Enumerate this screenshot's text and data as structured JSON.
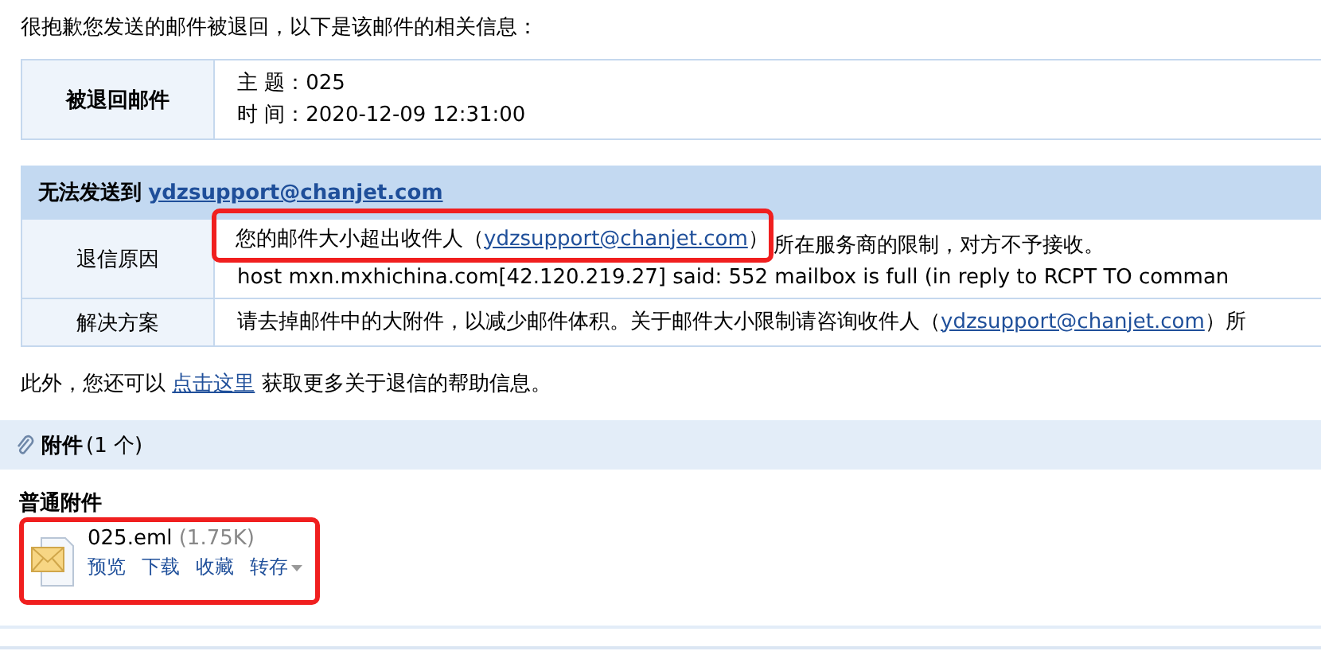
{
  "intro": "很抱歉您发送的邮件被退回，以下是该邮件的相关信息：",
  "returned_mail": {
    "label": "被退回邮件",
    "lines": [
      "主 题：025",
      "时 间：2020-12-09 12:31:00"
    ]
  },
  "failure": {
    "heading": "无法发送到",
    "address": "ydzsupport@chanjet.com",
    "rows": [
      {
        "label": "退信原因",
        "lines": [
          {
            "before": "您的邮件大小超出收件人（",
            "link": "ydzsupport@chanjet.com",
            "close": "）",
            "after": "所在服务商的限制，对方不予接收。",
            "highlighted": true
          },
          {
            "before": "host mxn.mxhichina.com[42.120.219.27] said: 552 mailbox is full (in reply to RCPT TO comman",
            "highlighted": false
          }
        ]
      },
      {
        "label": "解决方案",
        "lines": [
          {
            "before": "请去掉邮件中的大附件，以减少邮件体积。关于邮件大小限制请咨询收件人（",
            "link": "ydzsupport@chanjet.com",
            "close": "）所",
            "highlighted": false
          }
        ]
      }
    ]
  },
  "help": {
    "before": "此外，您还可以",
    "link": "点击这里",
    "after": "获取更多关于退信的帮助信息。"
  },
  "attachments": {
    "title": "附件",
    "count": "(1 个)",
    "group": "普通附件",
    "files": [
      {
        "name": "025.eml",
        "size": "(1.75K)",
        "actions": [
          "预览",
          "下载",
          "收藏",
          "转存"
        ],
        "highlighted": true
      }
    ]
  }
}
